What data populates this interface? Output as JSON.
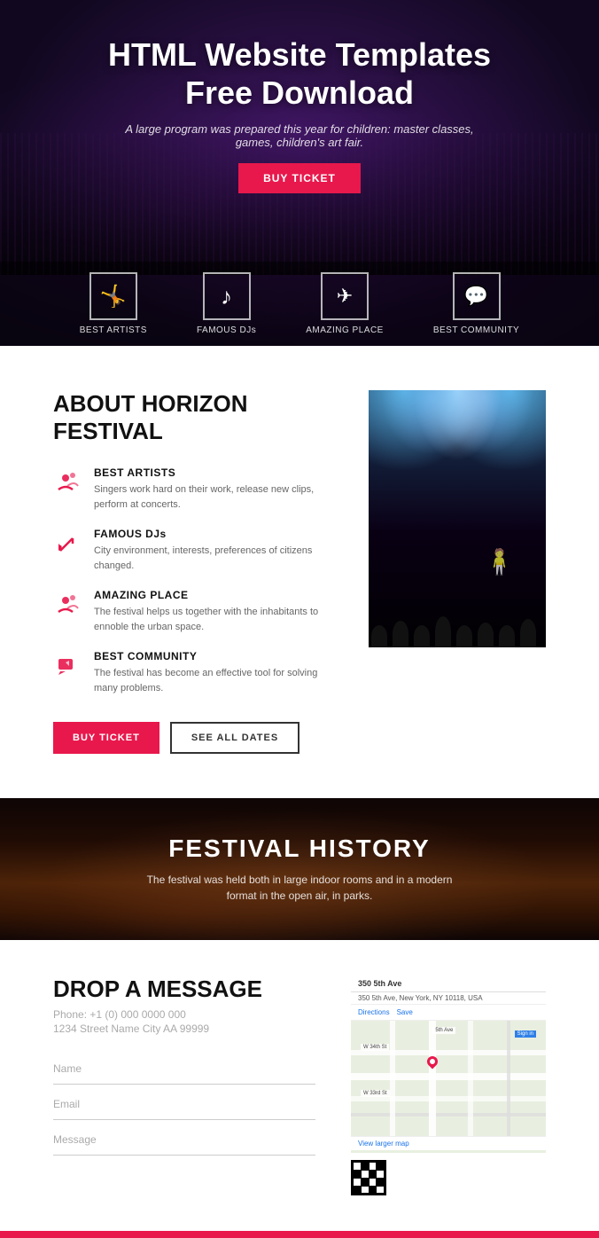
{
  "hero": {
    "title_line1": "HTML Website Templates",
    "title_line2": "Free Download",
    "subtitle": "A large program was prepared this year for children: master classes, games, children's art fair.",
    "buy_ticket_label": "BUY TICKET",
    "icons": [
      {
        "id": "person-icon",
        "symbol": "✦",
        "label": "BEST ARTISTS"
      },
      {
        "id": "music-icon",
        "symbol": "♪",
        "label": "FAMOUS DJs"
      },
      {
        "id": "plane-icon",
        "symbol": "✈",
        "label": "AMAZING PLACE"
      },
      {
        "id": "chat-icon",
        "symbol": "💬",
        "label": "BEST COMMUNITY"
      }
    ]
  },
  "about": {
    "title": "ABOUT HORIZON FESTIVAL",
    "items": [
      {
        "id": "best-artists",
        "title": "BEST ARTISTS",
        "description": "Singers work hard on their work, release new clips, perform at concerts."
      },
      {
        "id": "famous-djs",
        "title": "FAMOUS DJs",
        "description": "City environment, interests, preferences of citizens changed."
      },
      {
        "id": "amazing-place",
        "title": "AMAZING PLACE",
        "description": "The festival helps us together with the inhabitants to ennoble the urban space."
      },
      {
        "id": "best-community",
        "title": "BEST COMMUNITY",
        "description": "The festival has become an effective tool for solving many problems."
      }
    ],
    "buy_ticket_label": "BUY TICKET",
    "see_all_dates_label": "SEE ALL DATES"
  },
  "festival_history": {
    "title": "FESTIVAL HISTORY",
    "description": "The festival was held both in large indoor rooms and in a modern format in the open air, in parks."
  },
  "contact": {
    "title": "DROP A MESSAGE",
    "phone": "Phone: +1 (0) 000 0000 000",
    "address": "1234 Street Name City AA 99999",
    "form": {
      "name_placeholder": "Name",
      "email_placeholder": "Email",
      "message_placeholder": "Message"
    },
    "map": {
      "header": "350 5th Ave",
      "subheader": "350 5th Ave, New York, NY 10118, USA",
      "action1": "Directions",
      "action2": "Save",
      "view_larger": "View larger map"
    }
  },
  "icons": {
    "person": "🤸",
    "music_note": "♪",
    "plane": "✈",
    "chat_bubble": "💬",
    "chat_red_1": "💬",
    "arrow_red": "➤",
    "chat_red_2": "💬",
    "pencil_red": "✏️"
  }
}
